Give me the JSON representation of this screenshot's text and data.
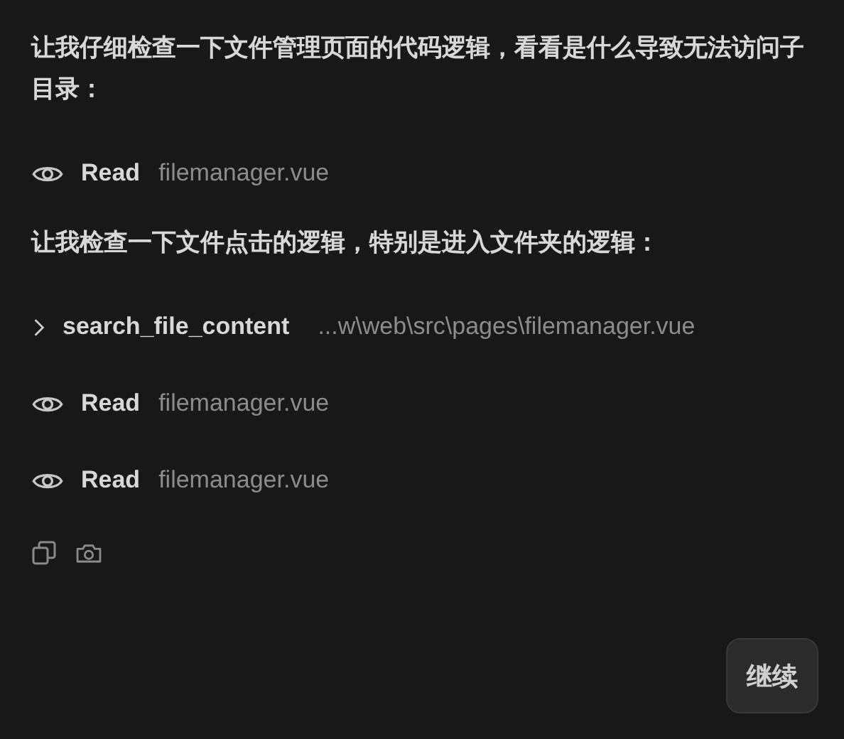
{
  "messages": [
    {
      "kind": "text",
      "text": "让我仔细检查一下文件管理页面的代码逻辑，看看是什么导致无法访问子目录："
    },
    {
      "kind": "read",
      "label": "Read",
      "target": "filemanager.vue"
    },
    {
      "kind": "text",
      "text": "让我检查一下文件点击的逻辑，特别是进入文件夹的逻辑："
    },
    {
      "kind": "search",
      "label": "search_file_content",
      "target": "...w\\web\\src\\pages\\filemanager.vue",
      "expanded": false
    },
    {
      "kind": "read",
      "label": "Read",
      "target": "filemanager.vue"
    },
    {
      "kind": "read",
      "label": "Read",
      "target": "filemanager.vue"
    }
  ],
  "continue_button": "继续"
}
